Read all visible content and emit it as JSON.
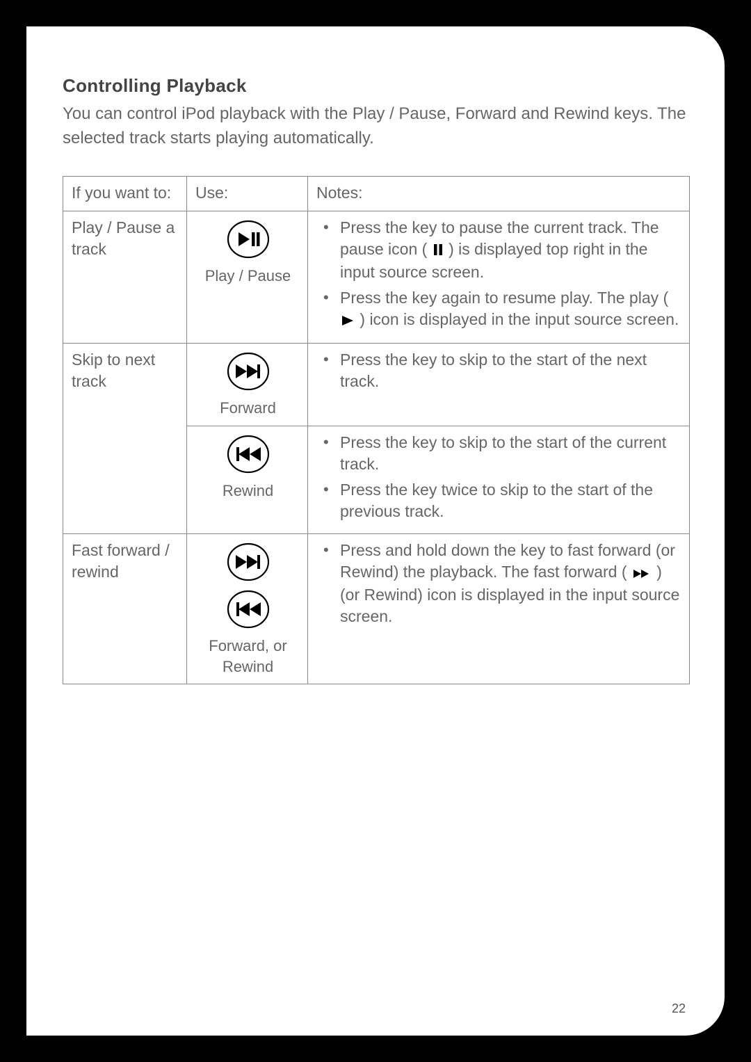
{
  "title": "Controlling Playback",
  "intro": "You can control iPod playback with the Play / Pause, Forward and Rewind keys. The selected track starts playing automatically.",
  "headers": {
    "c1": "If you want to:",
    "c2": "Use:",
    "c3": "Notes:"
  },
  "rows": {
    "r1": {
      "want": "Play / Pause a track",
      "use_label": "Play / Pause",
      "notes": {
        "n1a": "Press the key to pause the current track. The pause icon (",
        "n1b": ") is displayed top right in the input source screen.",
        "n2a": "Press the key again to resume play. The play (",
        "n2b": ") icon is displayed in the input source screen."
      }
    },
    "r2a": {
      "want": "Skip to next track",
      "use_label": "Forward",
      "notes": {
        "n1": "Press the key to skip to the start of the next track."
      }
    },
    "r2b": {
      "use_label": "Rewind",
      "notes": {
        "n1": "Press the key to skip to the start of the current track.",
        "n2": "Press the key twice to skip to the start of the previous track."
      }
    },
    "r3": {
      "want": "Fast forward / rewind",
      "use_label": "Forward, or Rewind",
      "notes": {
        "n1a": "Press and hold down the key to fast forward (or Rewind) the playback. The fast forward (",
        "n1b": ") (or Rewind) icon is displayed in the input source screen."
      }
    }
  },
  "page_number": "22"
}
